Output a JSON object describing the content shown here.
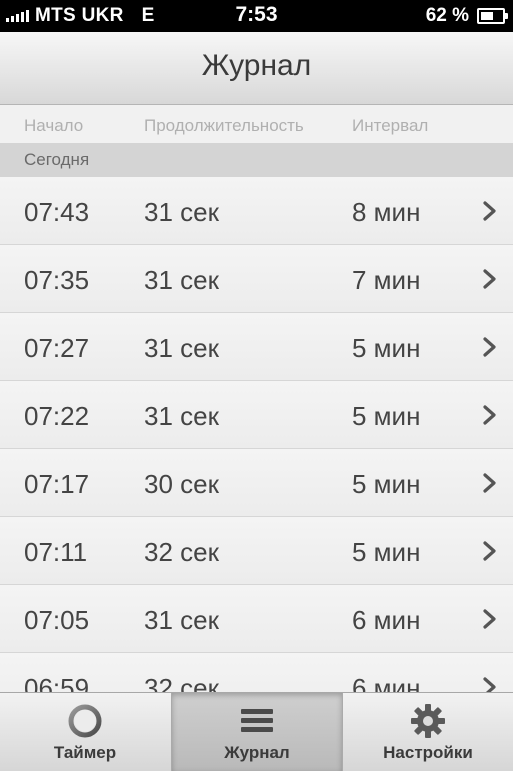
{
  "status_bar": {
    "carrier": "MTS UKR",
    "network": "E",
    "time": "7:53",
    "battery_percent_text": "62 %",
    "battery_level": 0.62
  },
  "nav": {
    "title": "Журнал"
  },
  "columns": {
    "start": "Начало",
    "duration": "Продолжительность",
    "interval": "Интервал"
  },
  "section": {
    "title": "Сегодня"
  },
  "rows": [
    {
      "start": "07:43",
      "duration": "31 сек",
      "interval": "8 мин"
    },
    {
      "start": "07:35",
      "duration": "31 сек",
      "interval": "7 мин"
    },
    {
      "start": "07:27",
      "duration": "31 сек",
      "interval": "5 мин"
    },
    {
      "start": "07:22",
      "duration": "31 сек",
      "interval": "5 мин"
    },
    {
      "start": "07:17",
      "duration": "30 сек",
      "interval": "5 мин"
    },
    {
      "start": "07:11",
      "duration": "32 сек",
      "interval": "5 мин"
    },
    {
      "start": "07:05",
      "duration": "31 сек",
      "interval": "6 мин"
    },
    {
      "start": "06:59",
      "duration": "32 сек",
      "interval": "6 мин"
    }
  ],
  "tabs": [
    {
      "label": "Таймер",
      "icon": "timer-ring-icon",
      "selected": false
    },
    {
      "label": "Журнал",
      "icon": "list-lines-icon",
      "selected": true
    },
    {
      "label": "Настройки",
      "icon": "gear-icon",
      "selected": false
    }
  ],
  "colors": {
    "status_bar_bg": "#000000",
    "text_main": "#444444",
    "text_header": "#b0b0b0",
    "section_bg": "#d4d4d4"
  }
}
